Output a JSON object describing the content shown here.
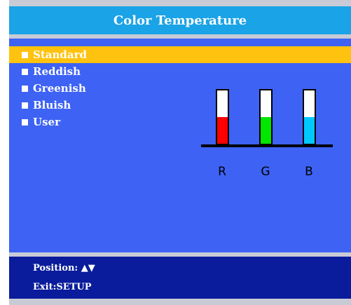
{
  "title": "Color Temperature",
  "menu": {
    "items": [
      {
        "label": "Standard",
        "selected": true
      },
      {
        "label": "Reddish",
        "selected": false
      },
      {
        "label": "Greenish",
        "selected": false
      },
      {
        "label": "Bluish",
        "selected": false
      },
      {
        "label": "User",
        "selected": false
      }
    ]
  },
  "rgb": {
    "channels": [
      {
        "label": "R",
        "color": "#ff0000",
        "level": 0.5
      },
      {
        "label": "G",
        "color": "#00e600",
        "level": 0.5
      },
      {
        "label": "B",
        "color": "#00c8ff",
        "level": 0.5
      }
    ]
  },
  "footer": {
    "position_label": "Position:",
    "position_icon": "▲▼",
    "exit_label": "Exit:",
    "exit_key": "SETUP"
  },
  "colors": {
    "title_bar": "#1aa3e6",
    "background": "#3d62f4",
    "highlight": "#ffc20e",
    "footer": "#0a1c9c"
  }
}
